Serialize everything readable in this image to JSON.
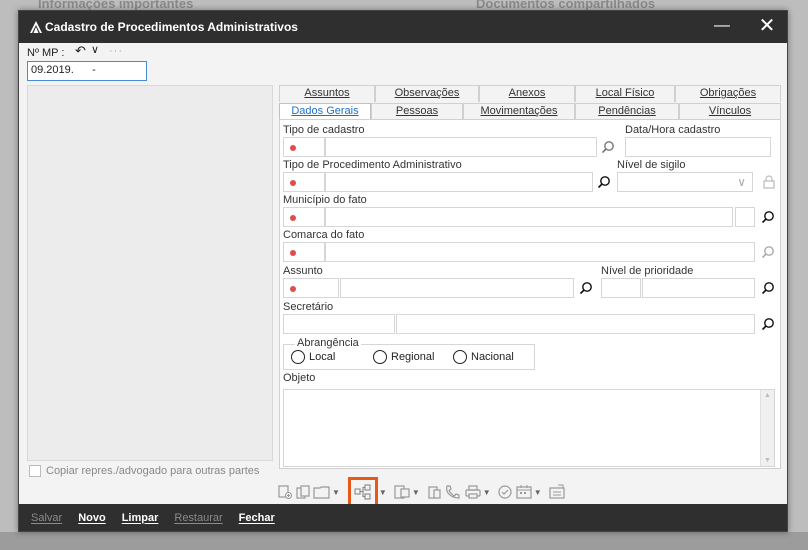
{
  "backdrop": {
    "panel_a": "Informações importantes",
    "panel_b": "Documentos compartilhados"
  },
  "window": {
    "title": "Cadastro de Procedimentos Administrativos",
    "minimize": "—",
    "close": "✕"
  },
  "mp": {
    "label": "Nº MP :",
    "value": "09.2019.      -"
  },
  "copy_checkbox": {
    "label": "Copiar repres./advogado para outras partes"
  },
  "tabs": {
    "row1": [
      "Assuntos",
      "Observações",
      "Anexos",
      "Local Físico",
      "Obrigações"
    ],
    "row2": [
      "Dados Gerais",
      "Pessoas",
      "Movimentações",
      "Pendências",
      "Vínculos"
    ],
    "active": "Dados Gerais"
  },
  "form": {
    "tipo_cadastro": "Tipo de cadastro",
    "data_hora": "Data/Hora cadastro",
    "tipo_procedimento": "Tipo de Procedimento Administrativo",
    "nivel_sigilo": "Nível de sigilo",
    "municipio": "Município do fato",
    "comarca": "Comarca do fato",
    "assunto": "Assunto",
    "nivel_prioridade": "Nível de prioridade",
    "secretario": "Secretário",
    "abrangencia": "Abrangência",
    "radio_local": "Local",
    "radio_regional": "Regional",
    "radio_nacional": "Nacional",
    "objeto": "Objeto"
  },
  "footer": {
    "salvar": "Salvar",
    "novo": "Novo",
    "limpar": "Limpar",
    "restaurar": "Restaurar",
    "fechar": "Fechar"
  },
  "colors": {
    "titlebar": "#2f2f2f",
    "active_tab": "#1e6fc8",
    "required_dot": "#e24b4b",
    "highlight": "#e8581a"
  }
}
